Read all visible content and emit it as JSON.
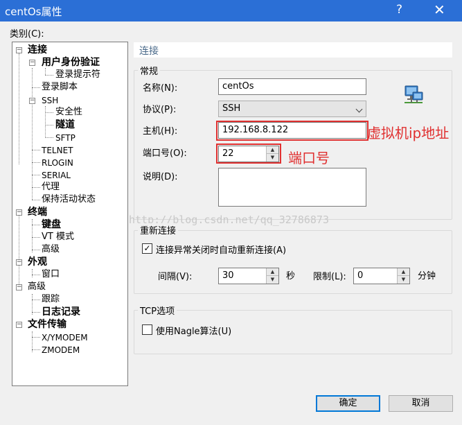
{
  "window": {
    "title": "centOs属性",
    "help_glyph": "?",
    "close_glyph": "✕"
  },
  "category_label": "类别(C):",
  "tree": [
    {
      "label": "连接",
      "bold": true
    },
    {
      "label": "用户身份验证",
      "bold": true
    },
    {
      "label": "登录提示符"
    },
    {
      "label": "登录脚本"
    },
    {
      "label": "SSH",
      "small": true
    },
    {
      "label": "安全性"
    },
    {
      "label": "隧道",
      "bold": true
    },
    {
      "label": "SFTP",
      "small": true
    },
    {
      "label": "TELNET",
      "small": true
    },
    {
      "label": "RLOGIN",
      "small": true
    },
    {
      "label": "SERIAL",
      "small": true
    },
    {
      "label": "代理"
    },
    {
      "label": "保持活动状态"
    },
    {
      "label": "终端",
      "bold": true
    },
    {
      "label": "键盘",
      "bold": true
    },
    {
      "label": "VT 模式"
    },
    {
      "label": "高级"
    },
    {
      "label": "外观",
      "bold": true
    },
    {
      "label": "窗口"
    },
    {
      "label": "高级"
    },
    {
      "label": "跟踪"
    },
    {
      "label": "日志记录",
      "bold": true
    },
    {
      "label": "文件传输",
      "bold": true
    },
    {
      "label": "X/YMODEM",
      "small": true
    },
    {
      "label": "ZMODEM",
      "small": true
    }
  ],
  "section_header": "连接",
  "general": {
    "title": "常规",
    "name_label": "名称(N):",
    "name_value": "centOs",
    "protocol_label": "协议(P):",
    "protocol_value": "SSH",
    "host_label": "主机(H):",
    "host_value": "192.168.8.122",
    "port_label": "端口号(O):",
    "port_value": "22",
    "desc_label": "说明(D):",
    "desc_value": ""
  },
  "annotations": {
    "host": "虚拟机ip地址",
    "port": "端口号"
  },
  "watermark": "http://blog.csdn.net/qq_32786873",
  "reconnect": {
    "title": "重新连接",
    "auto_label": "连接异常关闭时自动重新连接(A)",
    "auto_checked": "✓",
    "interval_label": "间隔(V):",
    "interval_value": "30",
    "interval_unit": "秒",
    "limit_label": "限制(L):",
    "limit_value": "0",
    "limit_unit": "分钟"
  },
  "tcp": {
    "title": "TCP选项",
    "nagle_label": "使用Nagle算法(U)",
    "nagle_checked": ""
  },
  "buttons": {
    "ok": "确定",
    "cancel": "取消"
  },
  "colors": {
    "titlebar": "#2b6fd6",
    "annotation": "#e03030",
    "primary_border": "#0078d7"
  }
}
